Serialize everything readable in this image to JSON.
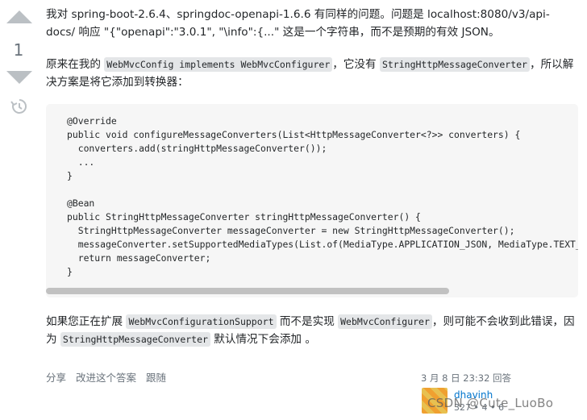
{
  "votes": {
    "count": "1"
  },
  "answer": {
    "p1": "我对 spring-boot-2.6.4、springdoc-openapi-1.6.6 有同样的问题。问题是 localhost:8080/v3/api-docs/ 响应 \"{\"openapi\":\"3.0.1\", \"\\info\":{...\" 这是一个字符串，而不是预期的有效 JSON。",
    "p2_a": "原来在我的 ",
    "p2_code1": "WebMvcConfig implements WebMvcConfigurer",
    "p2_b": "，它没有 ",
    "p2_code2": "StringHttpMessageConverter",
    "p2_c": "，所以解决方案是将它添加到转换器：",
    "code": "@Override\npublic void configureMessageConverters(List<HttpMessageConverter<?>> converters) {\n  converters.add(stringHttpMessageConverter());\n  ...\n}\n\n@Bean\npublic StringHttpMessageConverter stringHttpMessageConverter() {\n  StringHttpMessageConverter messageConverter = new StringHttpMessageConverter();\n  messageConverter.setSupportedMediaTypes(List.of(MediaType.APPLICATION_JSON, MediaType.TEXT_PLAIN));\n  return messageConverter;\n}",
    "p3_a": "如果您正在扩展 ",
    "p3_code1": "WebMvcConfigurationSupport",
    "p3_b": " 而不是实现 ",
    "p3_code2": "WebMvcConfigurer",
    "p3_c": "，则可能不会收到此错误，因为 ",
    "p3_code3": "StringHttpMessageConverter",
    "p3_d": " 默认情况下会添加 。"
  },
  "menu": {
    "share": "分享",
    "improve": "改进这个答案",
    "follow": "跟随"
  },
  "signature": {
    "answered": "3 月 8 日 23:32 回答",
    "username": "dhavinh",
    "rep": "327 • 4 • 6"
  },
  "watermark": "CSDN @Cute_LuoBo"
}
